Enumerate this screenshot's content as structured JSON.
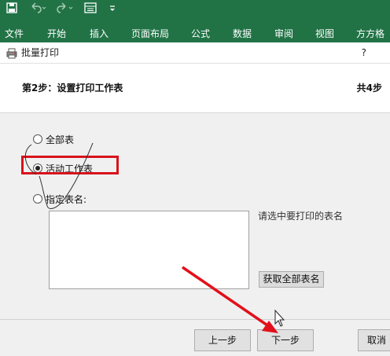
{
  "ribbon": {
    "qat": {
      "save_icon": "save-icon",
      "undo_icon": "undo-icon",
      "redo_icon": "redo-icon",
      "form_icon": "form-icon",
      "customize_icon": "customize-qat-icon"
    },
    "tabs": [
      "文件",
      "开始",
      "插入",
      "页面布局",
      "公式",
      "数据",
      "审阅",
      "视图",
      "方方格"
    ]
  },
  "dialog": {
    "title": "批量打印",
    "help": "?",
    "step_title": "第2步：设置打印工作表",
    "total_steps": "共4步",
    "options": [
      {
        "label": "全部表",
        "selected": false
      },
      {
        "label": "活动工作表",
        "selected": true
      },
      {
        "label": "指定表名:",
        "selected": false
      }
    ],
    "hint": "请选中要打印的表名",
    "get_all_button": "获取全部表名",
    "prev_button": "上一步",
    "next_button": "下一步",
    "cancel_button": "取消"
  },
  "colors": {
    "ribbon_green": "#217346",
    "highlight_red": "#d9121b"
  }
}
